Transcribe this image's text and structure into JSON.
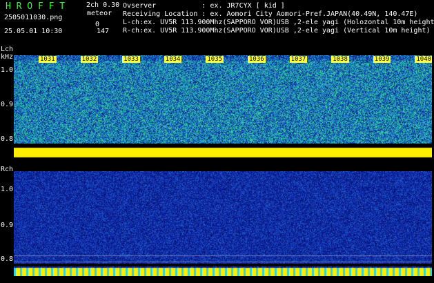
{
  "header": {
    "title": "H R O F F T",
    "mode": "2ch 0.30",
    "file": "2505011030.png",
    "meteor_label": "meteor",
    "meteor_count_1": "0",
    "datetime": "25.05.01 10:30",
    "meteor_count_2": "147"
  },
  "info": {
    "observer": "Ovserver           : ex. JR7CYX [ kid ]",
    "location": "Receiving Location : ex. Aomori City Aomori-Pref.JAPAN(40.49N, 140.47E)",
    "lch": "L-ch:ex. UV5R 113.900Mhz(SAPPORO VOR)USB ,2-ele yagi (Holozontal 10m height)",
    "rch": "R-ch:ex. UV5R 113.900Mhz(SAPPORO VOR)USB ,2-ele yagi (Vertical 10m height)"
  },
  "lch": {
    "label": "Lch",
    "unit": "kHz",
    "yticks": [
      "1.0",
      "0.9",
      "0.8"
    ],
    "time_ticks": [
      "1031",
      "1032",
      "1033",
      "1034",
      "1035",
      "1036",
      "1037",
      "1038",
      "1039",
      "1040"
    ]
  },
  "rch": {
    "label": "Rch",
    "yticks": [
      "1.0",
      "0.9",
      "0.8"
    ]
  },
  "colors": {
    "header_green": "#33ff33",
    "tick_yellow": "#ffff33",
    "noise_dark": "#1a2fa8",
    "noise_mid": "#1b7fc4",
    "noise_bright": "#3fd39a",
    "carrier": "#ffee00"
  }
}
